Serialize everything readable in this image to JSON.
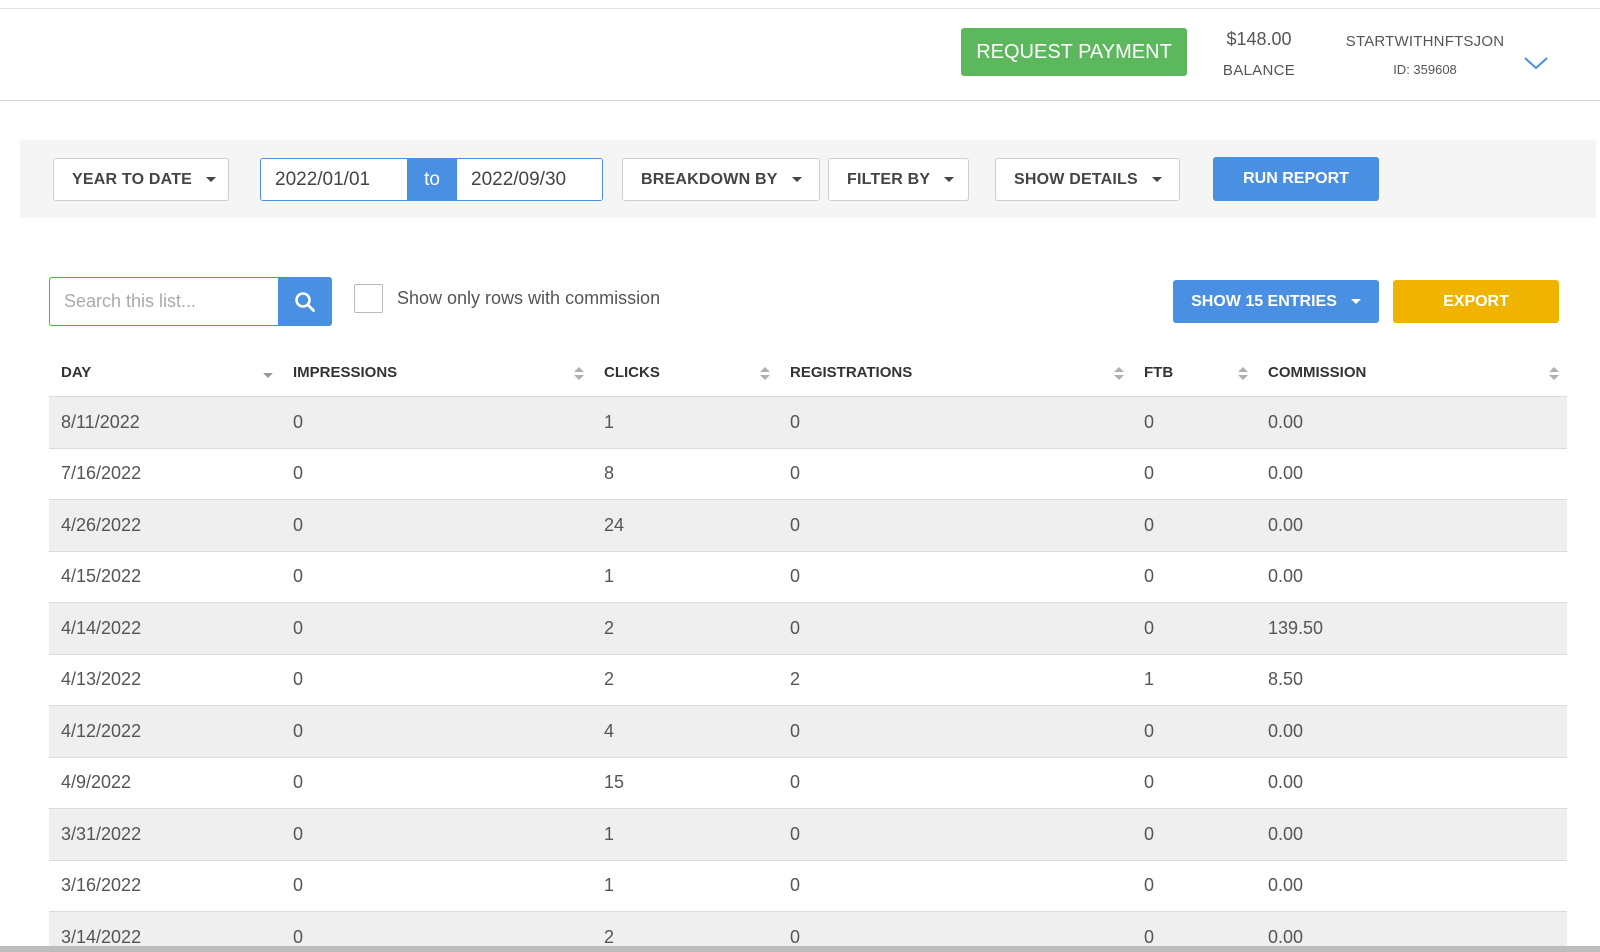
{
  "header": {
    "request_payment_label": "REQUEST PAYMENT",
    "balance_amount": "$148.00",
    "balance_label": "BALANCE",
    "user_name": "STARTWITHNFTSJON",
    "user_id": "ID: 359608"
  },
  "filters": {
    "period_label": "YEAR TO DATE",
    "date_from": "2022/01/01",
    "date_to_label": "to",
    "date_to": "2022/09/30",
    "breakdown_label": "BREAKDOWN BY",
    "filter_label": "FILTER BY",
    "details_label": "SHOW DETAILS",
    "run_label": "RUN REPORT"
  },
  "toolbar": {
    "search_placeholder": "Search this list...",
    "commission_only_label": "Show only rows with commission",
    "entries_label": "SHOW 15 ENTRIES",
    "export_label": "EXPORT"
  },
  "table": {
    "columns": [
      "DAY",
      "IMPRESSIONS",
      "CLICKS",
      "REGISTRATIONS",
      "FTB",
      "COMMISSION"
    ],
    "rows": [
      [
        "8/11/2022",
        "0",
        "1",
        "0",
        "0",
        "0.00"
      ],
      [
        "7/16/2022",
        "0",
        "8",
        "0",
        "0",
        "0.00"
      ],
      [
        "4/26/2022",
        "0",
        "24",
        "0",
        "0",
        "0.00"
      ],
      [
        "4/15/2022",
        "0",
        "1",
        "0",
        "0",
        "0.00"
      ],
      [
        "4/14/2022",
        "0",
        "2",
        "0",
        "0",
        "139.50"
      ],
      [
        "4/13/2022",
        "0",
        "2",
        "2",
        "1",
        "8.50"
      ],
      [
        "4/12/2022",
        "0",
        "4",
        "0",
        "0",
        "0.00"
      ],
      [
        "4/9/2022",
        "0",
        "15",
        "0",
        "0",
        "0.00"
      ],
      [
        "3/31/2022",
        "0",
        "1",
        "0",
        "0",
        "0.00"
      ],
      [
        "3/16/2022",
        "0",
        "1",
        "0",
        "0",
        "0.00"
      ],
      [
        "3/14/2022",
        "0",
        "2",
        "0",
        "0",
        "0.00"
      ]
    ]
  },
  "colors": {
    "success": "#5cb85c",
    "primary": "#4a90e2",
    "warning": "#f0b400",
    "row_alt": "#efefef"
  },
  "icons": [
    "chevron-down-icon",
    "caret-down-icon",
    "search-icon",
    "sort-icon"
  ]
}
